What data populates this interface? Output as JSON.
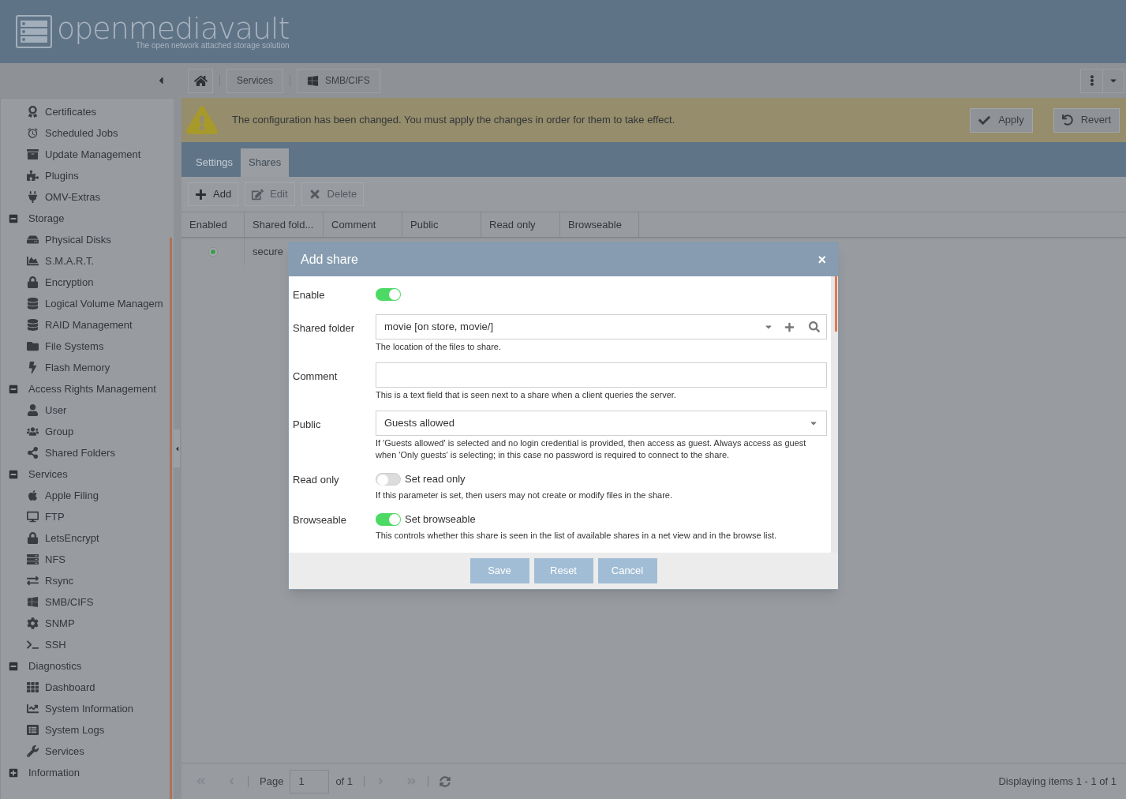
{
  "header": {
    "logo_text": "openmediavault",
    "tagline": "The open network attached storage solution"
  },
  "breadcrumb": [
    {
      "label": "Services",
      "kind": "text"
    },
    {
      "label": "SMB/CIFS",
      "kind": "windows"
    }
  ],
  "sidebar": {
    "items": [
      {
        "label": "Certificates",
        "kind": "item"
      },
      {
        "label": "Scheduled Jobs",
        "kind": "item"
      },
      {
        "label": "Update Management",
        "kind": "item"
      },
      {
        "label": "Plugins",
        "kind": "item"
      },
      {
        "label": "OMV-Extras",
        "kind": "item"
      },
      {
        "label": "Storage",
        "kind": "group",
        "expanded": true,
        "children": [
          {
            "label": "Physical Disks"
          },
          {
            "label": "S.M.A.R.T."
          },
          {
            "label": "Encryption"
          },
          {
            "label": "Logical Volume Managem"
          },
          {
            "label": "RAID Management"
          },
          {
            "label": "File Systems"
          },
          {
            "label": "Flash Memory"
          }
        ]
      },
      {
        "label": "Access Rights Management",
        "kind": "group",
        "expanded": true,
        "children": [
          {
            "label": "User"
          },
          {
            "label": "Group"
          },
          {
            "label": "Shared Folders"
          }
        ]
      },
      {
        "label": "Services",
        "kind": "group",
        "expanded": true,
        "children": [
          {
            "label": "Apple Filing"
          },
          {
            "label": "FTP"
          },
          {
            "label": "LetsEncrypt"
          },
          {
            "label": "NFS"
          },
          {
            "label": "Rsync"
          },
          {
            "label": "SMB/CIFS"
          },
          {
            "label": "SNMP"
          },
          {
            "label": "SSH"
          }
        ]
      },
      {
        "label": "Diagnostics",
        "kind": "group",
        "expanded": true,
        "children": [
          {
            "label": "Dashboard"
          },
          {
            "label": "System Information"
          },
          {
            "label": "System Logs"
          },
          {
            "label": "Services"
          }
        ]
      },
      {
        "label": "Information",
        "kind": "group",
        "expanded": false
      }
    ]
  },
  "notice": {
    "message": "The configuration has been changed. You must apply the changes in order for them to take effect.",
    "buttons": [
      {
        "label": "Apply",
        "kind": "apply"
      },
      {
        "label": "Revert",
        "kind": "revert"
      }
    ]
  },
  "tabs": [
    {
      "label": "Settings",
      "selected": false
    },
    {
      "label": "Shares",
      "selected": true
    }
  ],
  "toolbar": [
    {
      "label": "Add",
      "kind": "add",
      "disabled": false
    },
    {
      "label": "Edit",
      "kind": "edit",
      "disabled": true
    },
    {
      "label": "Delete",
      "kind": "delete",
      "disabled": true
    }
  ],
  "table": {
    "columns": [
      "Enabled",
      "Shared fold...",
      "Comment",
      "Public",
      "Read only",
      "Browseable"
    ],
    "rows": [
      {
        "enabled": true,
        "shared_folder": "secure"
      }
    ]
  },
  "pager": {
    "page_label": "Page",
    "page": "1",
    "of": "of 1",
    "summary": "Displaying items 1 - 1 of 1"
  },
  "dialog": {
    "title": "Add share",
    "close": "×",
    "fields": [
      {
        "kind": "switch",
        "label": "Enable",
        "on": true
      },
      {
        "kind": "combo",
        "label": "Shared folder",
        "value": "movie [on store, movie/]",
        "help": "The location of the files to share."
      },
      {
        "kind": "text",
        "label": "Comment",
        "help": "This is a text field that is seen next to a share when a client queries the server."
      },
      {
        "kind": "select",
        "label": "Public",
        "value": "Guests allowed",
        "help": "If 'Guests allowed' is selected and no login credential is provided, then access as guest. Always access as guest when 'Only guests' is selecting; in this case no password is required to connect to the share."
      },
      {
        "kind": "switch",
        "label": "Read only",
        "on": false,
        "text": "Set read only",
        "help": "If this parameter is set, then users may not create or modify files in the share."
      },
      {
        "kind": "switch",
        "label": "Browseable",
        "on": true,
        "text": "Set browseable",
        "help": "This controls whether this share is seen in the list of available shares in a net view and in the browse list."
      }
    ],
    "buttons": [
      "Save",
      "Reset",
      "Cancel"
    ]
  }
}
